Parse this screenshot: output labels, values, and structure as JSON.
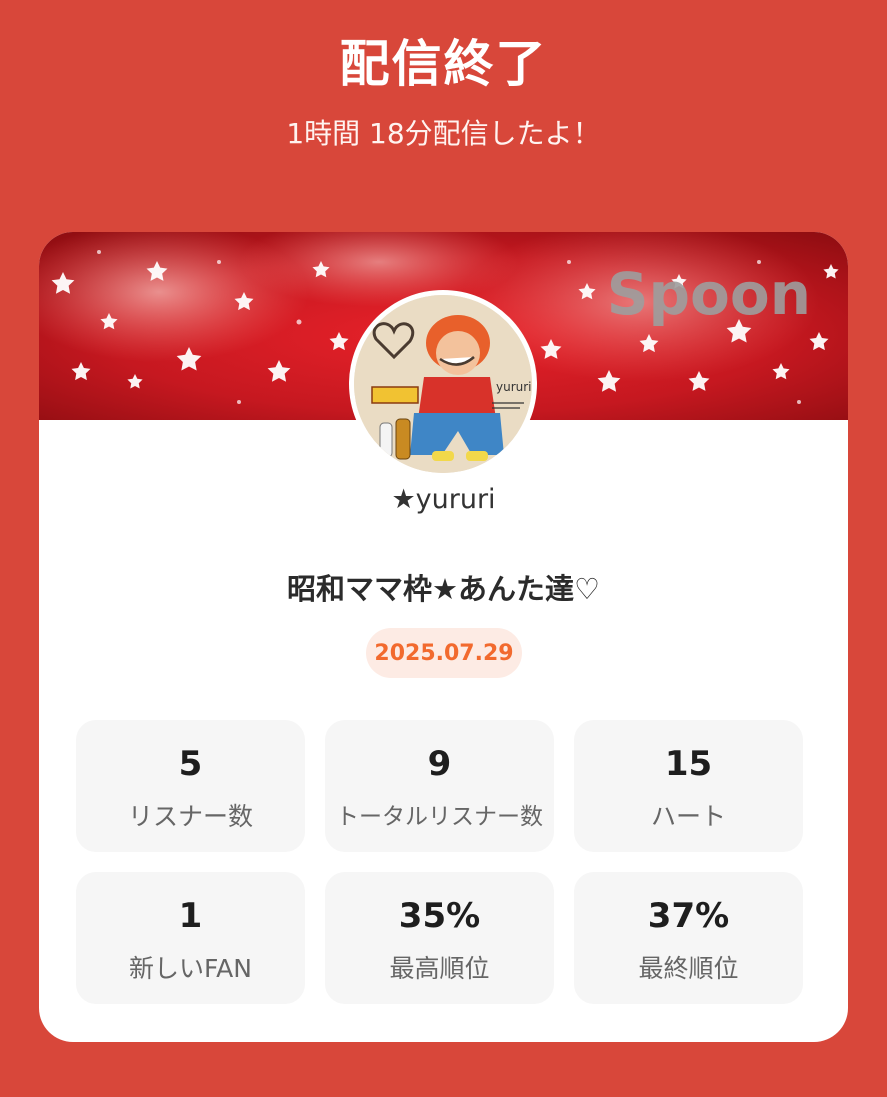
{
  "header": {
    "title": "配信終了",
    "subtitle": "1時間 18分配信したよ！"
  },
  "card": {
    "banner_logo": "Spoon",
    "avatar_icon": "profile-avatar",
    "username": "★yururi",
    "live_title": "昭和ママ枠★あんた達♡",
    "date": "2025.07.29"
  },
  "stats": [
    {
      "value": "5",
      "label": "リスナー数"
    },
    {
      "value": "9",
      "label": "トータルリスナー数"
    },
    {
      "value": "15",
      "label": "ハート"
    },
    {
      "value": "1",
      "label": "新しいFAN"
    },
    {
      "value": "35%",
      "label": "最高順位"
    },
    {
      "value": "37%",
      "label": "最終順位"
    }
  ],
  "colors": {
    "background": "#d8473a",
    "card": "#ffffff",
    "date_text": "#f26a2e",
    "date_badge": "#fdebe4",
    "stat_box": "#f6f6f6"
  }
}
